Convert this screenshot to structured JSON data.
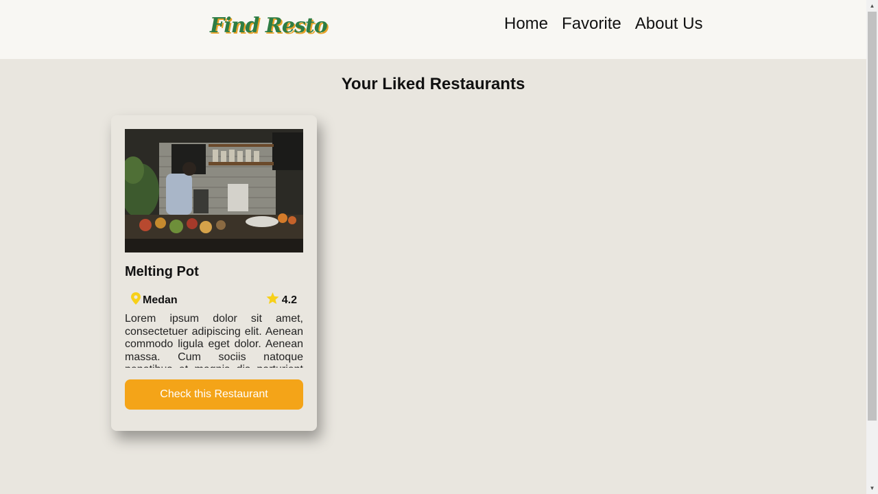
{
  "header": {
    "logo_text": "Find Resto",
    "nav": [
      {
        "label": "Home"
      },
      {
        "label": "Favorite"
      },
      {
        "label": "About Us"
      }
    ]
  },
  "main": {
    "title": "Your Liked Restaurants",
    "restaurants": [
      {
        "name": "Melting Pot",
        "city": "Medan",
        "rating": "4.2",
        "description": "Lorem ipsum dolor sit amet, consectetuer adipiscing elit. Aenean commodo ligula eget dolor. Aenean massa. Cum sociis natoque penatibus et magnis dis parturient montes, nascetur ridiculus mus.",
        "button_label": "Check this Restaurant"
      }
    ]
  },
  "colors": {
    "accent": "#f4a418",
    "background": "#e9e6df",
    "header": "#f8f7f3",
    "logo_green": "#2e7d44",
    "icon_yellow": "#f7d019"
  },
  "icons": {
    "location": "map-pin-icon",
    "rating": "star-icon"
  }
}
